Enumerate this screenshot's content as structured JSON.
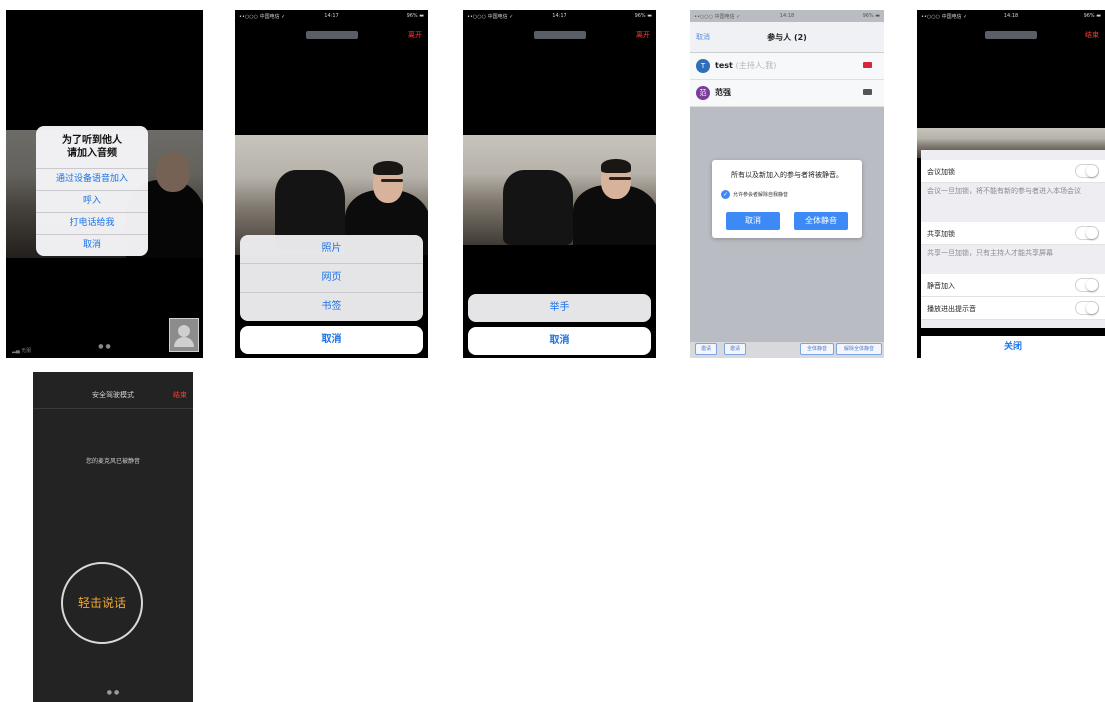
{
  "screen1": {
    "alert_title_line1": "为了听到他人",
    "alert_title_line2": "请加入音频",
    "options": [
      "通过设备语音加入",
      "呼入",
      "打电话给我",
      "取消"
    ],
    "signal": "无服"
  },
  "screen2": {
    "carrier": "••○○○ 中国电信 ✓",
    "time": "14:17",
    "battery": "96% ▬",
    "leave": "离开",
    "sheet_items": [
      "照片",
      "网页",
      "书签"
    ],
    "cancel": "取消"
  },
  "screen3": {
    "carrier": "••○○○ 中国电信 ✓",
    "time": "14:17",
    "battery": "96% ▬",
    "leave": "离开",
    "sheet_items": [
      "举手"
    ],
    "cancel": "取消"
  },
  "screen4": {
    "carrier": "••○○○ 中国电信 ✓",
    "time": "14:18",
    "battery": "96% ▬",
    "nav_left": "取消",
    "title": "参与人 (2)",
    "participants": [
      {
        "initial": "T",
        "name": "test",
        "note": "(主持人,我)",
        "avatar_color": "#2f6fb8",
        "cam_color": "#d6263a"
      },
      {
        "initial": "范",
        "name": "范强",
        "note": "",
        "avatar_color": "#7a3d9a",
        "cam_color": "#555555"
      }
    ],
    "dialog_message": "所有以及新加入的参与者将被静音。",
    "dialog_checkbox": "允许参会者解除自我静音",
    "dialog_cancel": "取消",
    "dialog_mute_all": "全体静音",
    "bottom_buttons": [
      "邀请",
      "邀请",
      "全体静音",
      "解除全体静音"
    ]
  },
  "screen5": {
    "carrier": "••○○○ 中国电信 ✓",
    "time": "14:18",
    "battery": "96% ▬",
    "end": "结束",
    "lock_meeting": "会议加锁",
    "lock_meeting_desc": "会议一旦加锁，将不能有新的参与者进入本场会议",
    "lock_share": "共享加锁",
    "lock_share_desc": "共享一旦加锁，只有主持人才能共享屏幕",
    "mute_on_join": "静音加入",
    "play_chime": "播放进出提示音",
    "close": "关闭"
  },
  "screen6": {
    "title": "安全驾驶模式",
    "end": "结束",
    "message": "您的麦克风已被静音",
    "tap_to_speak": "轻击说话"
  }
}
